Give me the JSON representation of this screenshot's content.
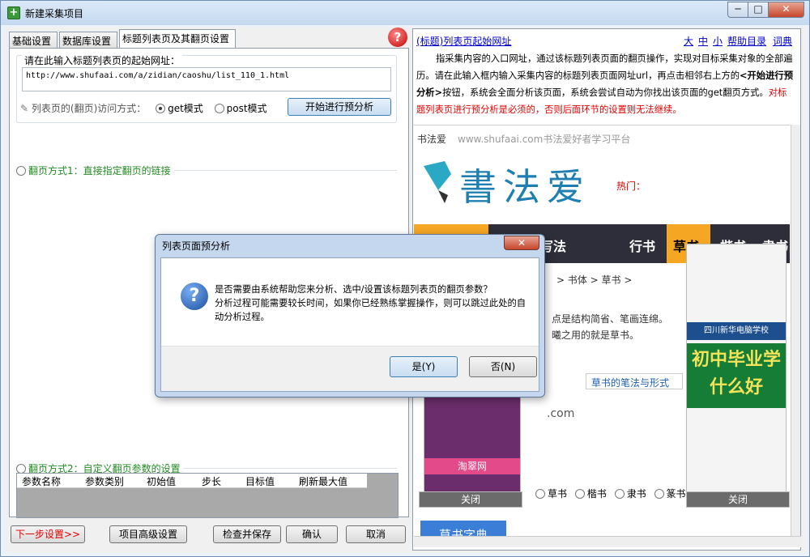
{
  "window": {
    "title": "新建采集项目",
    "min": "─",
    "max": "□",
    "close": "✕"
  },
  "tabs": [
    "基础设置",
    "数据库设置",
    "标题列表页及其翻页设置"
  ],
  "help_badge": "?",
  "url_group": {
    "legend": "请在此输入标题列表页的起始网址：",
    "url": "http://www.shufaai.com/a/zidian/caoshu/list_110_1.html",
    "visit_label": "列表页的(翻页)访问方式：",
    "get_label": "get模式",
    "post_label": "post模式",
    "analyze_button": "开始进行预分析"
  },
  "paging1": "翻页方式1：直接指定翻页的链接",
  "paging2": "翻页方式2：自定义翻页参数的设置",
  "param_columns": [
    "参数名称",
    "参数类别",
    "初始值",
    "步长",
    "目标值",
    "刷新最大值"
  ],
  "bottom": {
    "next": "下一步设置>>",
    "advanced": "项目高级设置",
    "check_save": "检查并保存",
    "ok": "确认",
    "cancel": "取消"
  },
  "help": {
    "title": "(标题)列表页起始网址",
    "links": [
      "大",
      "中",
      "小",
      "帮助目录",
      "词典"
    ],
    "p1": "指采集内容的入口网址，通过该标题列表页面的翻页操作，实现对目标采集对象的全部遍历。请在此输入框内输入采集内容的标题列表页面网址url，再点击相邻右上方的",
    "p1_bold": "<开始进行预分析>",
    "p1_after": "按钮，系统会全面分析该页面，系统会尝试自动为你找出该页面的get翻页方式。",
    "p1_red": "对标题列表页进行预分析是必须的，否则后面环节的设置则无法继续。"
  },
  "browser": {
    "site_text": "书法爱",
    "site_sub": "www.shufaai.com书法爱好者学习平台",
    "logo": "書法爱",
    "hot": "热门：",
    "nav": [
      "书字的写法",
      "行书",
      "草书",
      "楷书",
      "隶书"
    ],
    "breadcrumb": "> 书体 > 草书 >",
    "intro1": "点是结构简省、笔画连绵。",
    "intro2": "曦之用的就是草书。",
    "link1": "草书的笔法与形式",
    "ad_left": "淘翠网",
    "ad_right_title": "四川新华电脑学校",
    "ad_right_big": "初中毕业学什么好",
    "close1": "关闭",
    "close2": "关闭",
    "radios": [
      "草书",
      "楷书",
      "隶书",
      "篆书"
    ],
    "dict_button": "草书字典",
    "dot_com": ".com"
  },
  "dialog": {
    "title": "列表页面预分析",
    "close": "✕",
    "icon": "?",
    "line1": "是否需要由系统帮助您来分析、选中/设置该标题列表页的翻页参数？",
    "line2": "分析过程可能需要较长时间，如果你已经熟练掌握操作，则可以跳过此处的自动分析过程。",
    "yes": "是(Y)",
    "no": "否(N)"
  },
  "colors": {
    "accent": "#3c7fb1",
    "green": "#228b22",
    "red": "#e00000",
    "orange": "#f5a623"
  }
}
